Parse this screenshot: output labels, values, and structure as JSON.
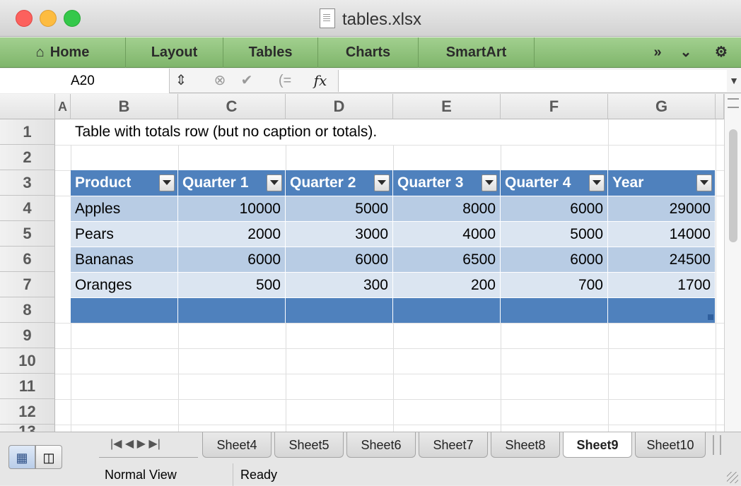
{
  "window": {
    "title": "tables.xlsx",
    "traffic_lights": [
      "#fc615d",
      "#fdbc40",
      "#34c84a"
    ]
  },
  "ribbon": {
    "tabs": [
      {
        "label": "Home",
        "icon": "home-icon"
      },
      {
        "label": "Layout"
      },
      {
        "label": "Tables"
      },
      {
        "label": "Charts"
      },
      {
        "label": "SmartArt"
      }
    ],
    "overflow_icon": "»",
    "collapse_icon": "⌄",
    "settings_icon": "⚙"
  },
  "formula_bar": {
    "name_box": "A20",
    "fx_label": "fx"
  },
  "grid": {
    "columns": [
      "A",
      "B",
      "C",
      "D",
      "E",
      "F",
      "G"
    ],
    "rows": [
      "1",
      "2",
      "3",
      "4",
      "5",
      "6",
      "7",
      "8",
      "9",
      "10",
      "11",
      "12",
      "13"
    ],
    "note": "Table with totals row (but no caption or totals).",
    "table": {
      "headers": [
        "Product",
        "Quarter 1",
        "Quarter 2",
        "Quarter 3",
        "Quarter 4",
        "Year"
      ],
      "rows": [
        [
          "Apples",
          "10000",
          "5000",
          "8000",
          "6000",
          "29000"
        ],
        [
          "Pears",
          "2000",
          "3000",
          "4000",
          "5000",
          "14000"
        ],
        [
          "Bananas",
          "6000",
          "6000",
          "6500",
          "6000",
          "24500"
        ],
        [
          "Oranges",
          "500",
          "300",
          "200",
          "700",
          "1700"
        ]
      ]
    }
  },
  "sheets": {
    "nav": "|◀ ◀ ▶ ▶|",
    "tabs": [
      "Sheet4",
      "Sheet5",
      "Sheet6",
      "Sheet7",
      "Sheet8",
      "Sheet9",
      "Sheet10"
    ],
    "active": "Sheet9"
  },
  "status": {
    "view": "Normal View",
    "state": "Ready"
  },
  "colors": {
    "ribbon_green": "#8cc07a",
    "table_header": "#4f81bd",
    "band_dark": "#b8cce4",
    "band_light": "#dbe5f1"
  }
}
